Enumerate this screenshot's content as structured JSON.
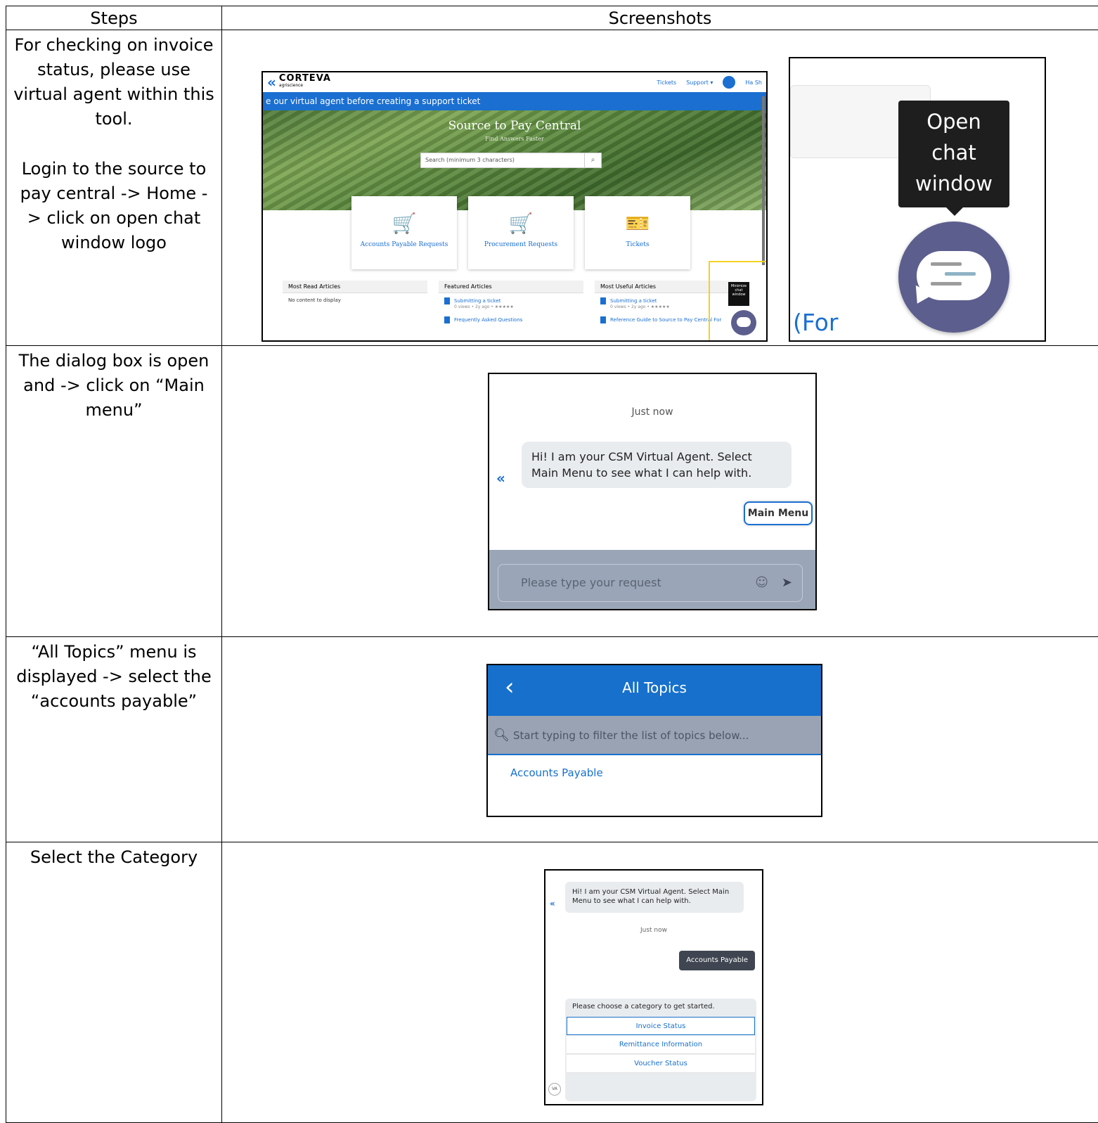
{
  "table": {
    "headers": {
      "steps": "Steps",
      "screenshots": "Screenshots"
    },
    "rows": [
      {
        "step_line1": "For checking on invoice status, please use virtual agent within this tool.",
        "step_line2": "Login to the source to pay central -> Home -> click on open chat window logo"
      },
      {
        "step": "The dialog box is open and -> click on “Main menu”"
      },
      {
        "step": "“All Topics” menu is displayed -> select the “accounts payable”"
      },
      {
        "step": "Select the Category"
      }
    ]
  },
  "portal": {
    "logo_text": "CORTEVA",
    "logo_sub": "agriscience",
    "nav_tickets": "Tickets",
    "nav_support": "Support ▾",
    "user": "Ha Sh",
    "banner": "e our virtual agent before creating a support ticket",
    "hero_title": "Source to Pay Central",
    "hero_sub": "Find Answers Faster",
    "search_placeholder": "Search (minimum 3 characters)",
    "tiles": [
      "Accounts Payable Requests",
      "Procurement Requests",
      "Tickets"
    ],
    "articles": {
      "most_read": "Most Read Articles",
      "no_content": "No content to display",
      "featured": "Featured Articles",
      "featured_1": "Submitting a ticket",
      "featured_1_meta": "0 views • 2y ago • ★★★★★",
      "featured_2": "Frequently Asked Questions",
      "most_useful": "Most Useful Articles",
      "useful_1": "Submitting a ticket",
      "useful_1_meta": "0 views • 2y ago • ★★★★★",
      "useful_2": "Reference Guide to Source to Pay Central For"
    },
    "mini_tooltip": "Minimize chat window"
  },
  "zoom": {
    "tooltip": "Open chat window",
    "tooltip_lines": [
      "Open",
      "chat",
      "window"
    ],
    "partial_text": "(For"
  },
  "chat": {
    "time": "Just now",
    "message": "Hi! I am your CSM Virtual Agent. Select Main Menu to see what I can help with.",
    "main_menu_button": "Main Menu",
    "input_placeholder": "Please type your request"
  },
  "topics": {
    "title": "All Topics",
    "search_placeholder": "Start typing to filter the list of topics below...",
    "items": [
      "Accounts Payable"
    ]
  },
  "category": {
    "message": "Hi! I am your CSM Virtual Agent. Select Main Menu to see what I can help with.",
    "time": "Just now",
    "user_reply": "Accounts Payable",
    "prompt": "Please choose a category to get started.",
    "options": [
      "Invoice Status",
      "Remittance Information",
      "Voucher Status"
    ],
    "avatar": "VA"
  },
  "colors": {
    "accent": "#1670cc",
    "chat_icon": "#5c5e8e",
    "highlight": "#f4d21f"
  }
}
